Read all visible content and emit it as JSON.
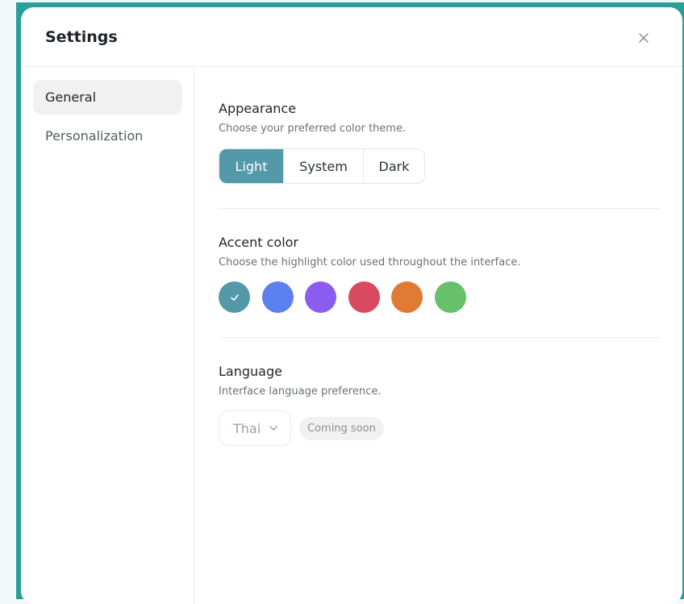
{
  "dialog": {
    "title": "Settings",
    "close_icon": "close-icon"
  },
  "sidebar": {
    "items": [
      {
        "label": "General",
        "active": true
      },
      {
        "label": "Personalization",
        "active": false
      }
    ]
  },
  "appearance": {
    "title": "Appearance",
    "description": "Choose your preferred color theme.",
    "options": [
      "Light",
      "System",
      "Dark"
    ],
    "selected": "Light"
  },
  "accent": {
    "title": "Accent color",
    "description": "Choose the highlight color used throughout the interface.",
    "colors": [
      {
        "name": "teal",
        "hex": "#5399a9",
        "selected": true
      },
      {
        "name": "blue",
        "hex": "#5a80f0",
        "selected": false
      },
      {
        "name": "purple",
        "hex": "#8b5cf0",
        "selected": false
      },
      {
        "name": "red",
        "hex": "#d94a60",
        "selected": false
      },
      {
        "name": "orange",
        "hex": "#e07a34",
        "selected": false
      },
      {
        "name": "green",
        "hex": "#67c06a",
        "selected": false
      }
    ]
  },
  "language": {
    "title": "Language",
    "description": "Interface language preference.",
    "value": "Thai",
    "badge": "Coming soon",
    "chevron_icon": "chevron-down-icon"
  }
}
